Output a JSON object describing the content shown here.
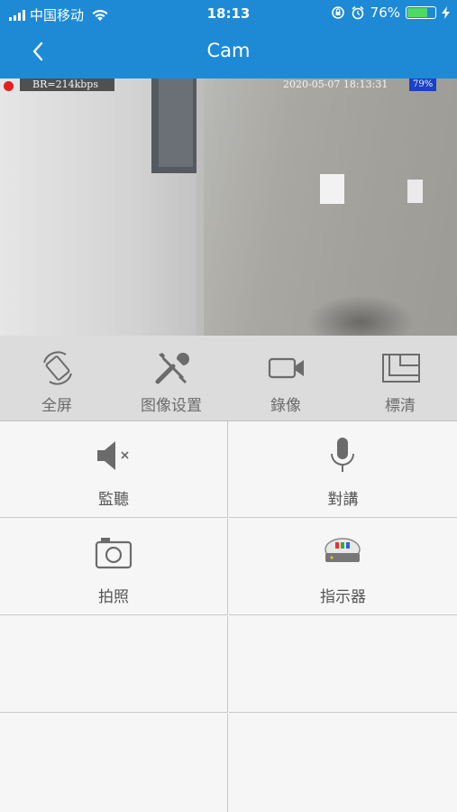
{
  "status_bar": {
    "carrier": "中国移动",
    "time": "18:13",
    "battery_percent_text": "76%",
    "battery_level": 0.76
  },
  "nav": {
    "title": "Cam",
    "back_icon": "chevron-left-icon"
  },
  "video_osd": {
    "bitrate": "BR=214kbps",
    "timestamp": "2020-05-07 18:13:31",
    "badge": "79%",
    "record_indicator_color": "#e52020"
  },
  "toolbar": {
    "items": [
      {
        "label": "全屏",
        "icon": "rotate-screen-icon"
      },
      {
        "label": "图像设置",
        "icon": "wrench-screwdriver-icon"
      },
      {
        "label": "錄像",
        "icon": "video-camera-icon"
      },
      {
        "label": "標清",
        "icon": "layout-quality-icon"
      }
    ]
  },
  "grid": {
    "items": [
      {
        "label": "監聽",
        "icon": "speaker-mute-icon"
      },
      {
        "label": "對講",
        "icon": "microphone-icon"
      },
      {
        "label": "拍照",
        "icon": "camera-icon"
      },
      {
        "label": "指示器",
        "icon": "indicator-lights-icon"
      }
    ]
  },
  "colors": {
    "header": "#1e8ad6",
    "toolbar_bg": "#dcdcdc",
    "icon_gray": "#6b6b6b"
  }
}
